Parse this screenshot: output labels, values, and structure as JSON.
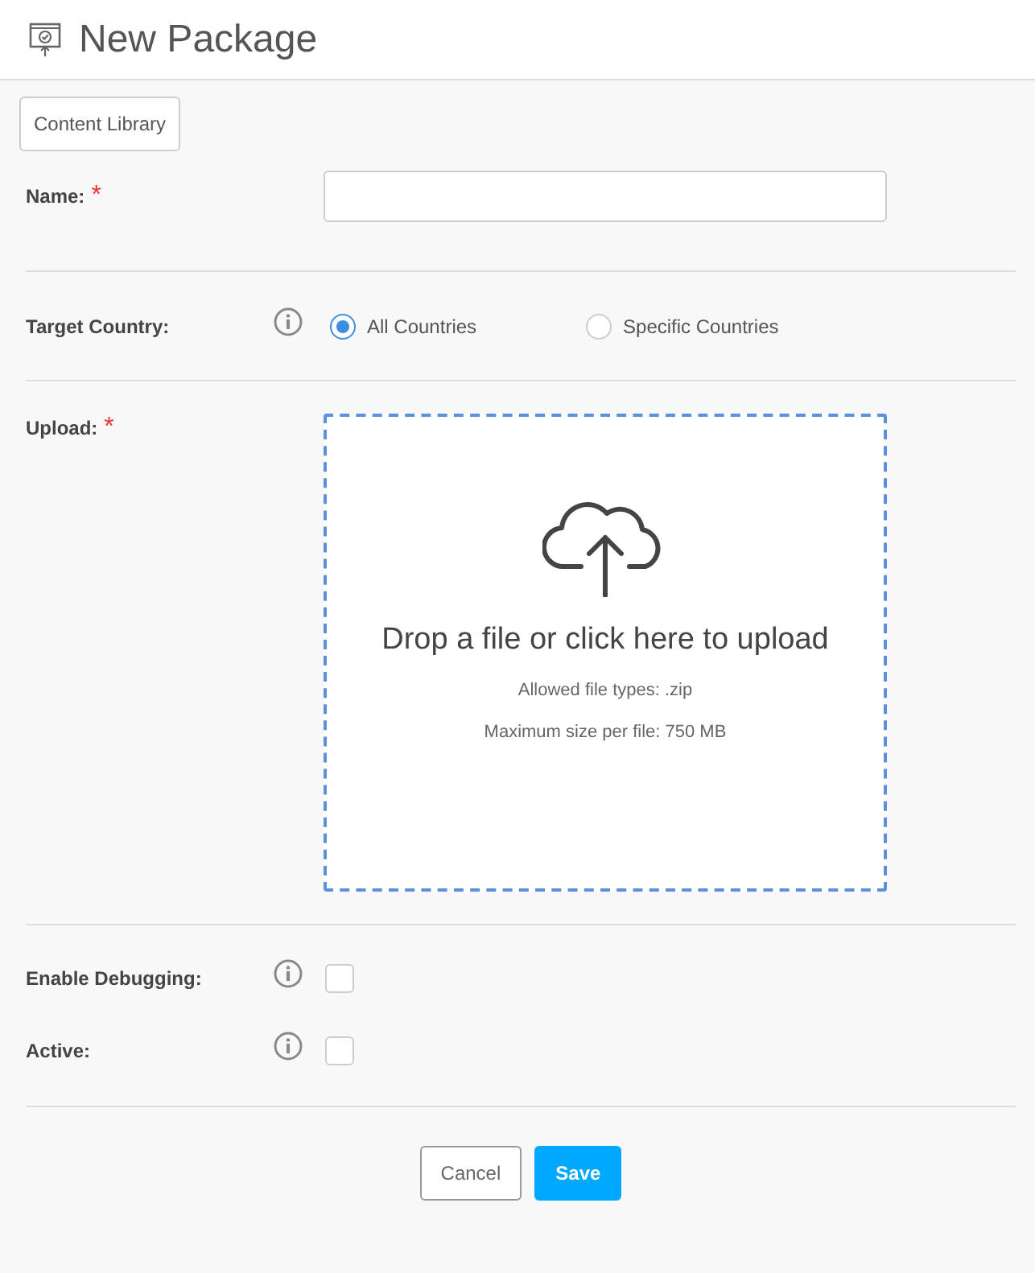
{
  "header": {
    "title": "New Package"
  },
  "toolbar": {
    "button": "Content Library"
  },
  "fields": [
    {
      "kind": "text",
      "label": "Name:",
      "required_mark": "*",
      "info": false
    },
    {
      "kind": "radio",
      "label": "Target Country:",
      "info": true,
      "options": [
        {
          "label": "All Countries",
          "selected": true
        },
        {
          "label": "Specific Countries",
          "selected": false
        }
      ]
    },
    {
      "kind": "upload",
      "label": "Upload:",
      "required_mark": "*",
      "info": false,
      "prompt": "Drop a file or click here to upload",
      "notes": [
        "Allowed file types: .zip",
        "Maximum size per file: 750 MB"
      ]
    },
    {
      "kind": "checkbox",
      "label": "Enable Debugging:",
      "info": true,
      "checked": false
    },
    {
      "kind": "checkbox",
      "label": "Active:",
      "info": true,
      "checked": false
    }
  ],
  "actions": {
    "cancel": "Cancel",
    "save": "Save"
  }
}
